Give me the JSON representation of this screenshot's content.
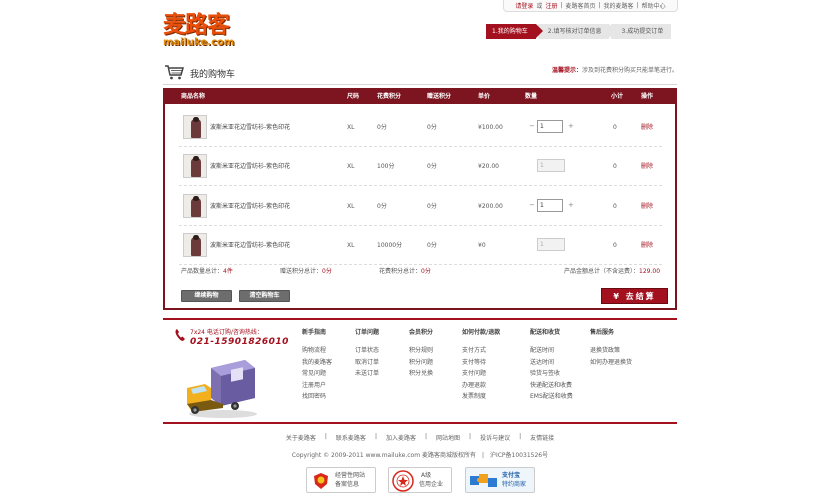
{
  "top_links": {
    "login": "请登录",
    "or": "或",
    "register": "注册",
    "sep": "|",
    "home": "麦路客首页",
    "my": "我的麦路客",
    "help": "帮助中心"
  },
  "logo": {
    "cn": "麦路客",
    "en": "mailuke.com"
  },
  "steps": [
    "1.我的购物车",
    "2.填写核对订单信息",
    "3.成功提交订单"
  ],
  "cart_title": "我的购物车",
  "tip": {
    "key": "温馨提示：",
    "text": "涉及到花费积分购买只能单笔进行。"
  },
  "columns": [
    "商品名称",
    "尺码",
    "花费积分",
    "赠送积分",
    "单价",
    "数量",
    "小计",
    "操作"
  ],
  "rows": [
    {
      "name": "波斯米亚花边雪纺衫-紫色印花",
      "size": "XL",
      "cost_points": "0分",
      "gift_points": "0分",
      "price": "¥100.00",
      "qty": "1",
      "editable": true,
      "subtotal": "0",
      "action": "删除"
    },
    {
      "name": "波斯米亚花边雪纺衫-紫色印花",
      "size": "XL",
      "cost_points": "100分",
      "gift_points": "0分",
      "price": "¥20.00",
      "qty": "1",
      "editable": false,
      "subtotal": "0",
      "action": "删除"
    },
    {
      "name": "波斯米亚花边雪纺衫-紫色印花",
      "size": "XL",
      "cost_points": "0分",
      "gift_points": "0分",
      "price": "¥200.00",
      "qty": "1",
      "editable": true,
      "subtotal": "0",
      "action": "删除"
    },
    {
      "name": "波斯米亚花边雪纺衫-紫色印花",
      "size": "XL",
      "cost_points": "10000分",
      "gift_points": "0分",
      "price": "¥0",
      "qty": "1",
      "editable": false,
      "subtotal": "0",
      "action": "删除"
    }
  ],
  "qty_minus": "−",
  "qty_plus": "+",
  "summary": {
    "count_label": "产品数量总计：",
    "count_value": "4件",
    "gift_label": "赠送积分总计：",
    "gift_value": "0分",
    "cost_label": "花费积分总计：",
    "cost_value": "0分",
    "total_label": "产品金额总计（不含运费）：",
    "total_value": "129.00"
  },
  "buttons": {
    "continue": "继续购物",
    "clear": "清空购物车",
    "checkout": "¥ 去结算"
  },
  "hotline": {
    "label": "7x24 电话订购/咨询热线：",
    "number": "021-15901826010"
  },
  "help_columns": [
    {
      "title": "新手指南",
      "items": [
        "购物流程",
        "我的麦路客",
        "常见问题",
        "注册用户",
        "找回密码"
      ]
    },
    {
      "title": "订单问题",
      "items": [
        "订单状态",
        "取消订单",
        "未送订单"
      ]
    },
    {
      "title": "会员积分",
      "items": [
        "积分规则",
        "积分问题",
        "积分兑换"
      ]
    },
    {
      "title": "如何付款/退款",
      "items": [
        "支付方式",
        "支付等待",
        "支付问题",
        "办理退款",
        "发票制度"
      ]
    },
    {
      "title": "配送和收货",
      "items": [
        "配送时间",
        "送达时间",
        "验货与签收",
        "快递配送和收费",
        "EMS配送和收费"
      ]
    },
    {
      "title": "售后服务",
      "items": [
        "退换货政策",
        "如何办理退换货"
      ]
    }
  ],
  "bottom_links": [
    "关于麦路客",
    "|",
    "联系麦路客",
    "|",
    "加入麦路客",
    "|",
    "网站地图",
    "|",
    "投诉与建议",
    "|",
    "友情链接"
  ],
  "copyright": "Copyright © 2009-2011 www.mailuke.com 麦路客商城版权所有　|　沪ICP备10031526号",
  "badges": [
    {
      "line1": "经营性网站",
      "line2": "备案信息"
    },
    {
      "line1": "A级",
      "line2": "信用企业"
    },
    {
      "line1": "支付宝",
      "line2": "特约商家"
    }
  ],
  "colors": {
    "brand_red": "#a3111e",
    "dark_red": "#7c1520",
    "logo_orange": "#e94e0a"
  }
}
